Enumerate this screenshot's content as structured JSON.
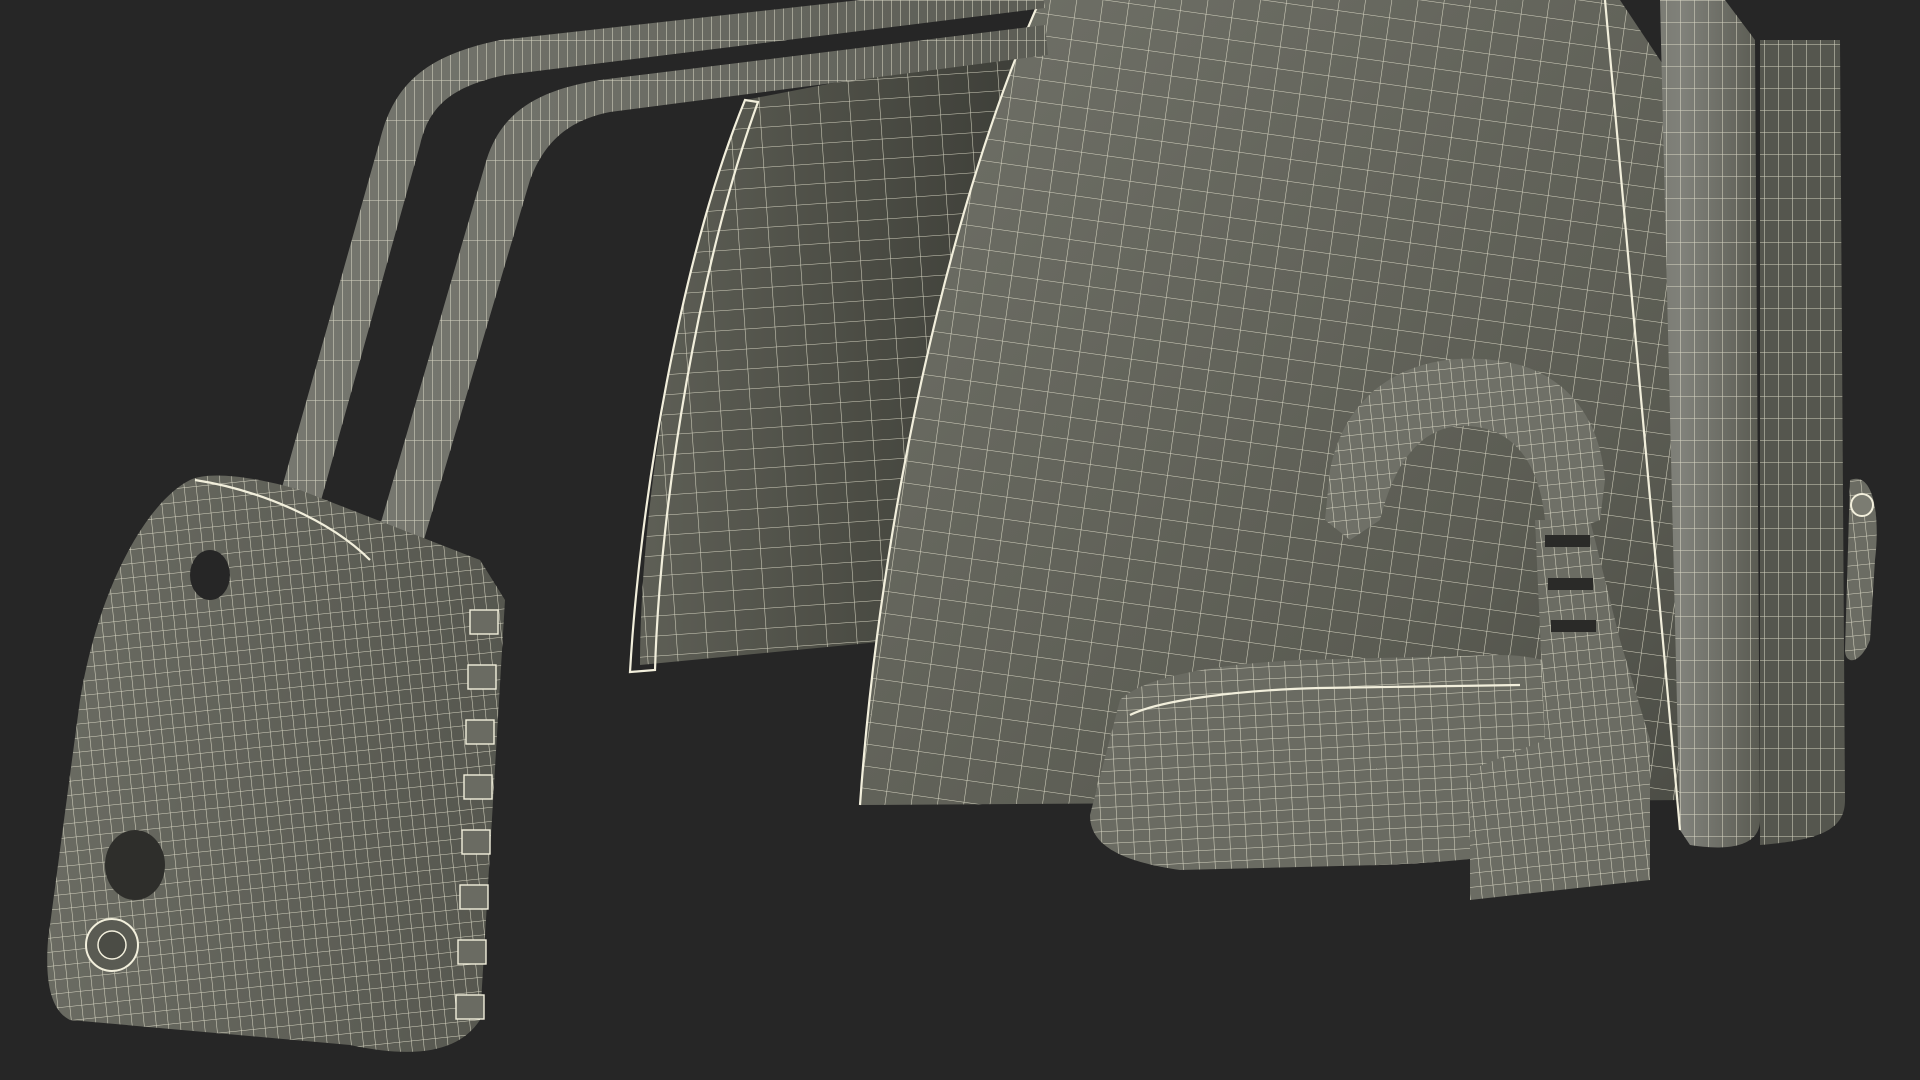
{
  "scene": {
    "background_color": "#262626",
    "surface_color": "#6b6c62",
    "surface_dark_color": "#4a4b43",
    "wire_color": "#e9e6d3"
  }
}
